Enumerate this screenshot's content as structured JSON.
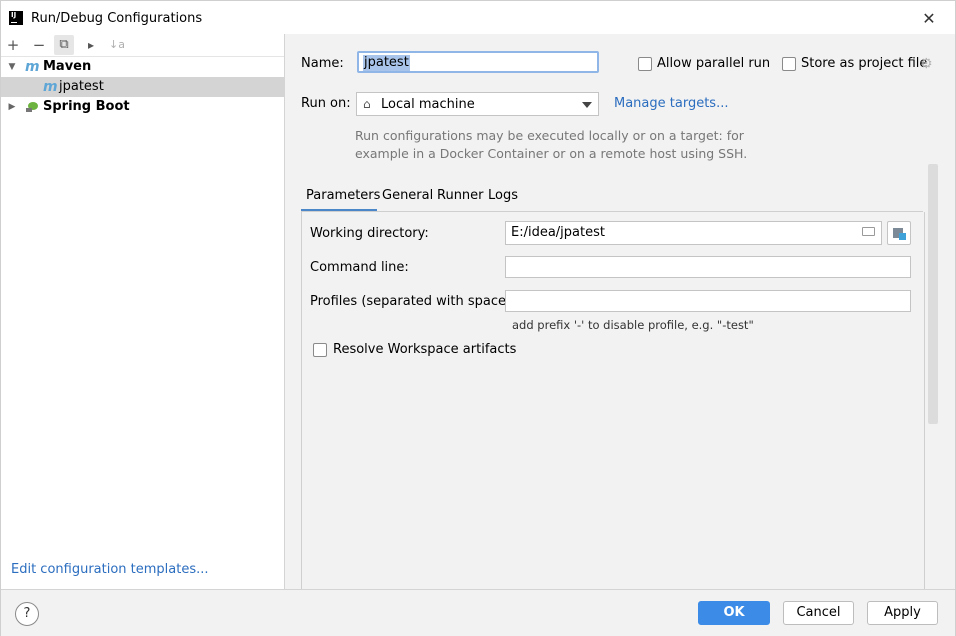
{
  "window": {
    "title": "Run/Debug Configurations",
    "icon_label": "IJ"
  },
  "toolbar": {
    "add": "+",
    "remove": "−",
    "copy": "⧉",
    "folder": "▸",
    "sort": "↓a"
  },
  "tree": {
    "maven": {
      "label": "Maven",
      "icon": "m"
    },
    "jpatest": {
      "label": "jpatest",
      "icon": "m"
    },
    "spring_boot": {
      "label": "Spring Boot"
    }
  },
  "edit_templates": "Edit configuration templates...",
  "form": {
    "name_label": "Name:",
    "name_value": "jpatest",
    "allow_parallel": "Allow parallel run",
    "store_project": "Store as project file",
    "run_on_label": "Run on:",
    "run_on_value": "Local machine",
    "manage_targets": "Manage targets...",
    "description_line1": "Run configurations may be executed locally or on a target: for",
    "description_line2": "example in a Docker Container or on a remote host using SSH."
  },
  "tabs": [
    "Parameters",
    "General",
    "Runner",
    "Logs"
  ],
  "params": {
    "working_dir_label": "Working directory:",
    "working_dir_value": "E:/idea/jpatest",
    "command_line_label": "Command line:",
    "command_line_value": "",
    "profiles_label": "Profiles (separated with space):",
    "profiles_value": "",
    "profiles_hint": "add prefix '-' to disable profile, e.g. \"-test\"",
    "resolve_workspace": "Resolve Workspace artifacts"
  },
  "buttons": {
    "help": "?",
    "ok": "OK",
    "cancel": "Cancel",
    "apply": "Apply"
  }
}
